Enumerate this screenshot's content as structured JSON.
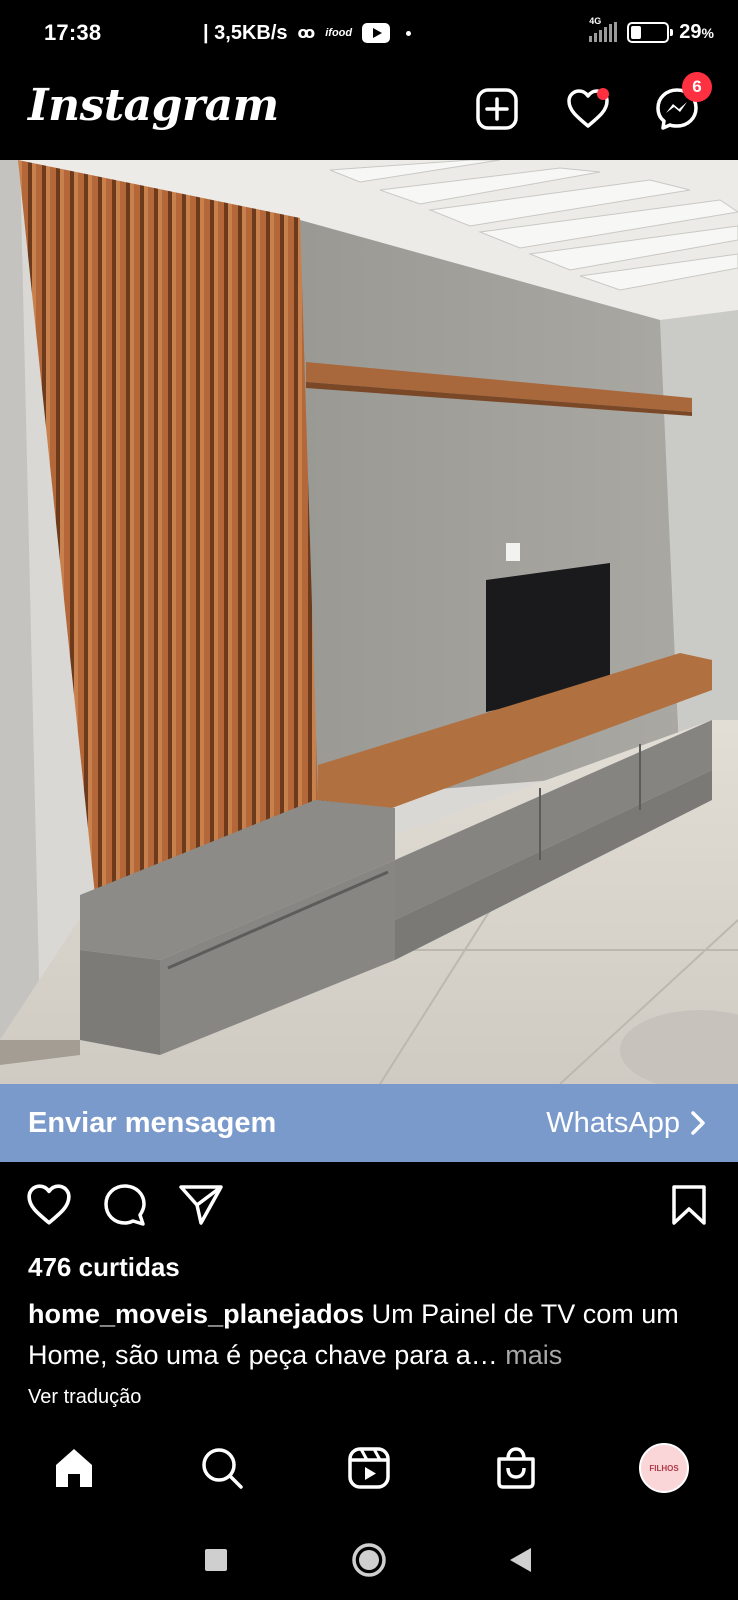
{
  "status_bar": {
    "time": "17:38",
    "speed": "| 3,5KB/s",
    "voicemail_glyph": "ꝏ",
    "carrier_glyph": "ifood",
    "network": "4G",
    "battery": "29",
    "battery_unit": "%",
    "battery_level": 0.29
  },
  "header": {
    "logo": "Instagram",
    "messages_badge": "6"
  },
  "post": {
    "cta_label": "Enviar mensagem",
    "cta_action": "WhatsApp",
    "likes": "476 curtidas",
    "username": "home_moveis_planejados",
    "caption": "Um Painel de TV com um Home,  são uma é peça chave para a…",
    "more": "mais",
    "translate": "Ver tradução"
  },
  "profile": {
    "avatar_text": "FILHOS"
  },
  "colors": {
    "cta_bg": "#7b9acc",
    "badge": "#ff3040"
  },
  "icons": [
    "new-post-icon",
    "heart-icon",
    "messenger-icon",
    "like-icon",
    "comment-icon",
    "share-icon",
    "save-icon",
    "home-icon",
    "search-icon",
    "reels-icon",
    "shop-icon",
    "square-icon",
    "circle-icon",
    "back-icon"
  ]
}
